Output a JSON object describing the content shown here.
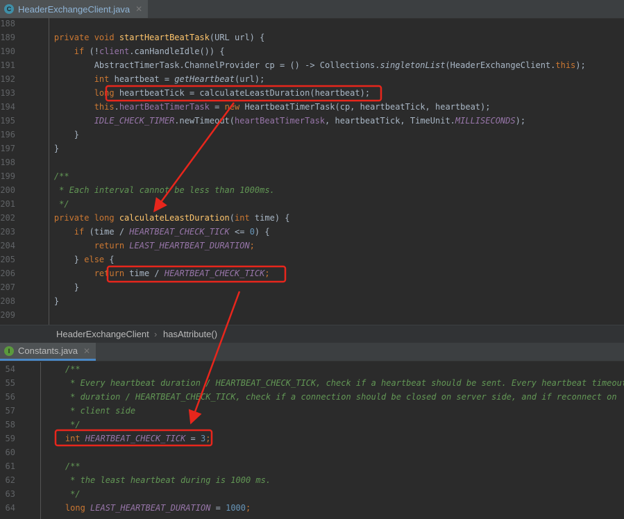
{
  "editor_top": {
    "tab": {
      "label": "HeaderExchangeClient.java",
      "icon": "class-icon",
      "icon_letter": "C",
      "icon_color": "#3f8fa8"
    },
    "lines": [
      {
        "n": "188",
        "t": []
      },
      {
        "n": "189",
        "t": [
          [
            "kw",
            "    private void "
          ],
          [
            "m",
            "startHeartBeatTask"
          ],
          [
            "",
            "(URL url) {"
          ]
        ]
      },
      {
        "n": "190",
        "t": [
          [
            "kw",
            "        if "
          ],
          [
            "",
            "(!"
          ],
          [
            "f",
            "client"
          ],
          [
            "",
            ".canHandleIdle()) {"
          ]
        ]
      },
      {
        "n": "191",
        "t": [
          [
            "",
            "            AbstractTimerTask.ChannelProvider cp = () -> Collections."
          ],
          [
            "mi",
            "singletonList"
          ],
          [
            "",
            "(HeaderExchangeClient."
          ],
          [
            "kw",
            "this"
          ],
          [
            "",
            ");"
          ]
        ]
      },
      {
        "n": "192",
        "t": [
          [
            "kw",
            "            int "
          ],
          [
            "",
            "heartbeat = "
          ],
          [
            "mi",
            "getHeartbeat"
          ],
          [
            "",
            "(url);"
          ]
        ]
      },
      {
        "n": "193",
        "t": [
          [
            "kw",
            "            long "
          ],
          [
            "",
            "heartbeatTick = calculateLeastDuration(heartbeat);"
          ]
        ]
      },
      {
        "n": "194",
        "t": [
          [
            "kw",
            "            this"
          ],
          [
            "",
            "."
          ],
          [
            "f",
            "heartBeatTimerTask"
          ],
          [
            "",
            " = "
          ],
          [
            "kw",
            "new "
          ],
          [
            "",
            "HeartbeatTimerTask(cp, heartbeatTick, heartbeat);"
          ]
        ]
      },
      {
        "n": "195",
        "t": [
          [
            "fi",
            "            IDLE_CHECK_TIMER"
          ],
          [
            "",
            ".newTimeout("
          ],
          [
            "f",
            "heartBeatTimerTask"
          ],
          [
            "",
            ", heartbeatTick, TimeUnit."
          ],
          [
            "fi",
            "MILLISECONDS"
          ],
          [
            "",
            ");"
          ]
        ]
      },
      {
        "n": "196",
        "t": [
          [
            "",
            "        }"
          ]
        ]
      },
      {
        "n": "197",
        "t": [
          [
            "",
            "    }"
          ]
        ]
      },
      {
        "n": "198",
        "t": []
      },
      {
        "n": "199",
        "t": [
          [
            "c",
            "    /**"
          ]
        ]
      },
      {
        "n": "200",
        "t": [
          [
            "c",
            "     * Each interval cannot be less than 1000ms."
          ]
        ]
      },
      {
        "n": "201",
        "t": [
          [
            "c",
            "     */"
          ]
        ]
      },
      {
        "n": "202",
        "t": [
          [
            "kw",
            "    private long "
          ],
          [
            "m",
            "calculateLeastDuration"
          ],
          [
            "",
            "("
          ],
          [
            "kw",
            "int "
          ],
          [
            "",
            "time) {"
          ]
        ]
      },
      {
        "n": "203",
        "t": [
          [
            "kw",
            "        if "
          ],
          [
            "",
            "(time / "
          ],
          [
            "fi",
            "HEARTBEAT_CHECK_TICK"
          ],
          [
            "",
            " <= "
          ],
          [
            "n",
            "0"
          ],
          [
            "",
            ") {"
          ]
        ]
      },
      {
        "n": "204",
        "t": [
          [
            "kw",
            "            return "
          ],
          [
            "fi",
            "LEAST_HEARTBEAT_DURATION"
          ],
          [
            "kw",
            ";"
          ]
        ]
      },
      {
        "n": "205",
        "t": [
          [
            "",
            "        } "
          ],
          [
            "kw",
            "else "
          ],
          [
            "",
            "{"
          ]
        ]
      },
      {
        "n": "206",
        "t": [
          [
            "kw",
            "            return "
          ],
          [
            "",
            "time / "
          ],
          [
            "fi",
            "HEARTBEAT_CHECK_TICK"
          ],
          [
            "kw",
            ";"
          ]
        ]
      },
      {
        "n": "207",
        "t": [
          [
            "",
            "        }"
          ]
        ]
      },
      {
        "n": "208",
        "t": [
          [
            "",
            "    }"
          ]
        ]
      },
      {
        "n": "209",
        "t": []
      }
    ]
  },
  "breadcrumb": {
    "items": [
      "HeaderExchangeClient",
      "hasAttribute()"
    ],
    "separator": "›"
  },
  "editor_bottom": {
    "tab": {
      "label": "Constants.java",
      "icon": "interface-icon",
      "icon_letter": "I",
      "icon_color": "#5b9a3d"
    },
    "lines": [
      {
        "n": "54",
        "t": [
          [
            "c",
            "    /**"
          ]
        ]
      },
      {
        "n": "55",
        "t": [
          [
            "c",
            "     * Every heartbeat duration / HEARTBEAT_CHECK_TICK, check if a heartbeat should be sent. Every heartbeat timeout"
          ]
        ]
      },
      {
        "n": "56",
        "t": [
          [
            "c",
            "     * duration / HEARTBEAT_CHECK_TICK, check if a connection should be closed on server side, and if reconnect on"
          ]
        ]
      },
      {
        "n": "57",
        "t": [
          [
            "c",
            "     * client side"
          ]
        ]
      },
      {
        "n": "58",
        "t": [
          [
            "c",
            "     */"
          ]
        ]
      },
      {
        "n": "59",
        "t": [
          [
            "kw",
            "    int "
          ],
          [
            "fi",
            "HEARTBEAT_CHECK_TICK"
          ],
          [
            "",
            " = "
          ],
          [
            "n",
            "3"
          ],
          [
            "kw",
            ";"
          ]
        ]
      },
      {
        "n": "60",
        "t": []
      },
      {
        "n": "61",
        "t": [
          [
            "c",
            "    /**"
          ]
        ]
      },
      {
        "n": "62",
        "t": [
          [
            "c",
            "     * the least heartbeat during is 1000 ms."
          ]
        ]
      },
      {
        "n": "63",
        "t": [
          [
            "c",
            "     */"
          ]
        ]
      },
      {
        "n": "64",
        "t": [
          [
            "kw",
            "    long "
          ],
          [
            "fi",
            "LEAST_HEARTBEAT_DURATION"
          ],
          [
            "",
            " = "
          ],
          [
            "n",
            "1000"
          ],
          [
            "kw",
            ";"
          ]
        ]
      }
    ]
  },
  "annotation_color": "#e8261c"
}
